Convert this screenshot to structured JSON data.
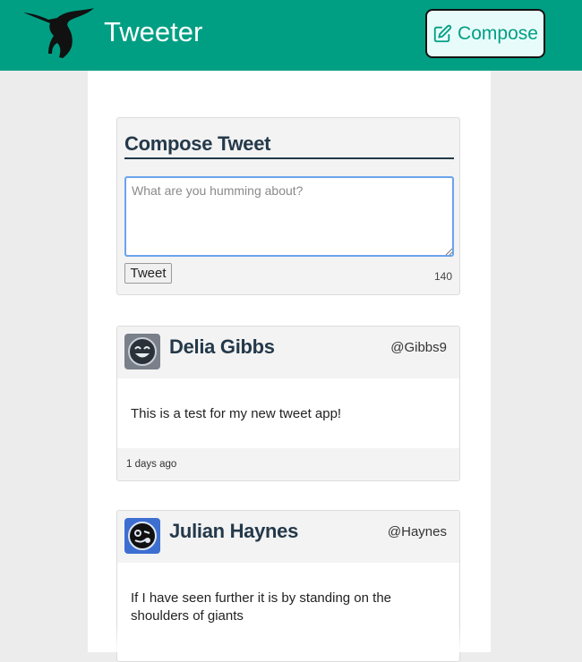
{
  "header": {
    "brand": "Tweeter",
    "compose_label": "Compose",
    "accent_color": "#009f83",
    "logo_icon": "hummingbird-icon",
    "compose_icon": "edit-icon"
  },
  "compose": {
    "title": "Compose Tweet",
    "placeholder": "What are you humming about?",
    "value": "",
    "submit_label": "Tweet",
    "counter": "140"
  },
  "tweets": [
    {
      "name": "Delia Gibbs",
      "handle": "@Gibbs9",
      "text": "This is a test for my new tweet app!",
      "timestamp": "1 days ago",
      "avatar_icon": "smiling-face-avatar"
    },
    {
      "name": "Julian Haynes",
      "handle": "@Haynes",
      "text": "If I have seen further it is by standing on the shoulders of giants",
      "timestamp": "",
      "avatar_icon": "winking-face-avatar"
    }
  ]
}
